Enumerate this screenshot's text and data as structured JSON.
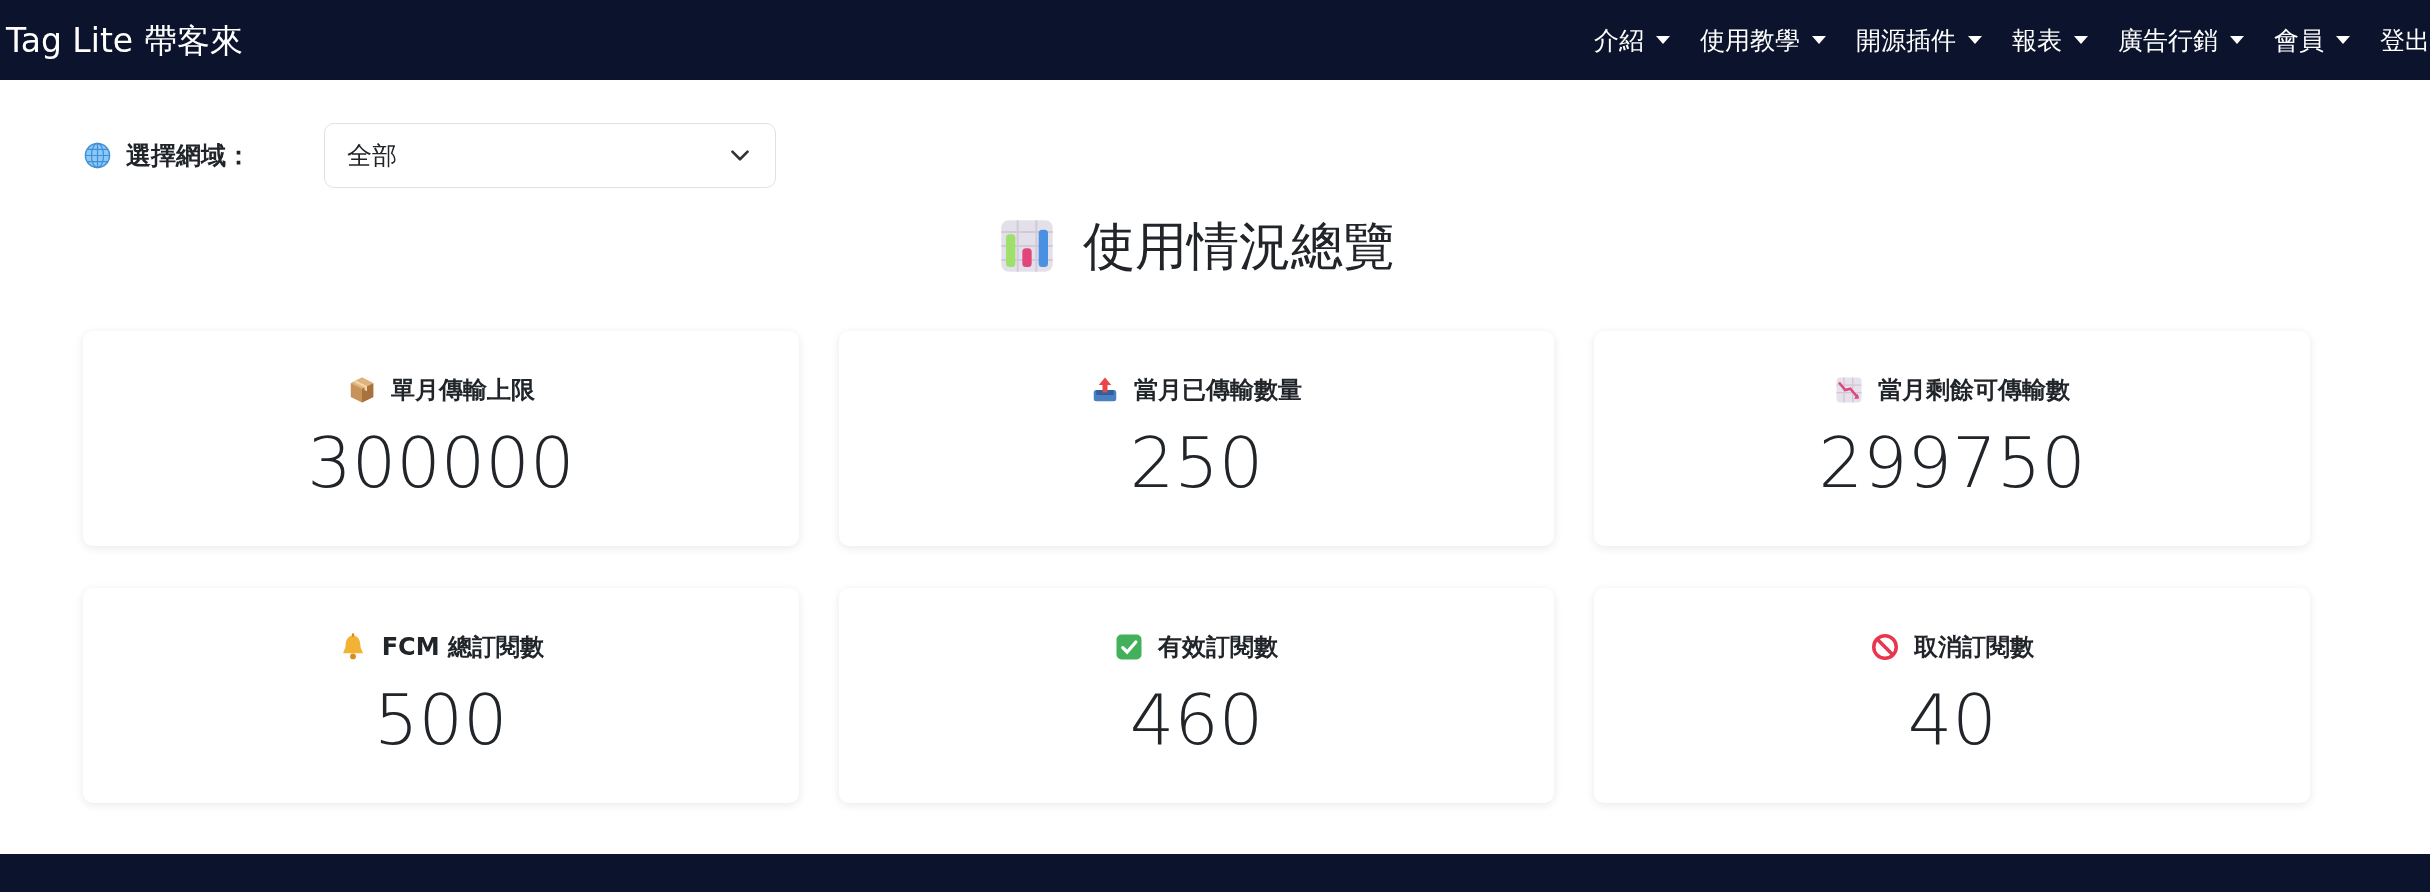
{
  "navbar": {
    "brand": "Tag Lite 帶客來",
    "items": [
      {
        "label": "介紹",
        "dropdown": true
      },
      {
        "label": "使用教學",
        "dropdown": true
      },
      {
        "label": "開源插件",
        "dropdown": true
      },
      {
        "label": "報表",
        "dropdown": true
      },
      {
        "label": "廣告行銷",
        "dropdown": true
      },
      {
        "label": "會員",
        "dropdown": true
      },
      {
        "label": "登出",
        "dropdown": false
      }
    ]
  },
  "domain_filter": {
    "label": "選擇網域：",
    "value": "全部"
  },
  "title": "使用情況總覽",
  "stats": [
    {
      "kind": "box",
      "label": "單月傳輸上限",
      "value": "300000"
    },
    {
      "kind": "outbox",
      "label": "當月已傳輸數量",
      "value": "250"
    },
    {
      "kind": "decrease",
      "label": "當月剩餘可傳輸數",
      "value": "299750"
    },
    {
      "kind": "bell",
      "label": "FCM 總訂閱數",
      "value": "500"
    },
    {
      "kind": "check",
      "label": "有效訂閱數",
      "value": "460"
    },
    {
      "kind": "prohibited",
      "label": "取消訂閱數",
      "value": "40"
    }
  ]
}
